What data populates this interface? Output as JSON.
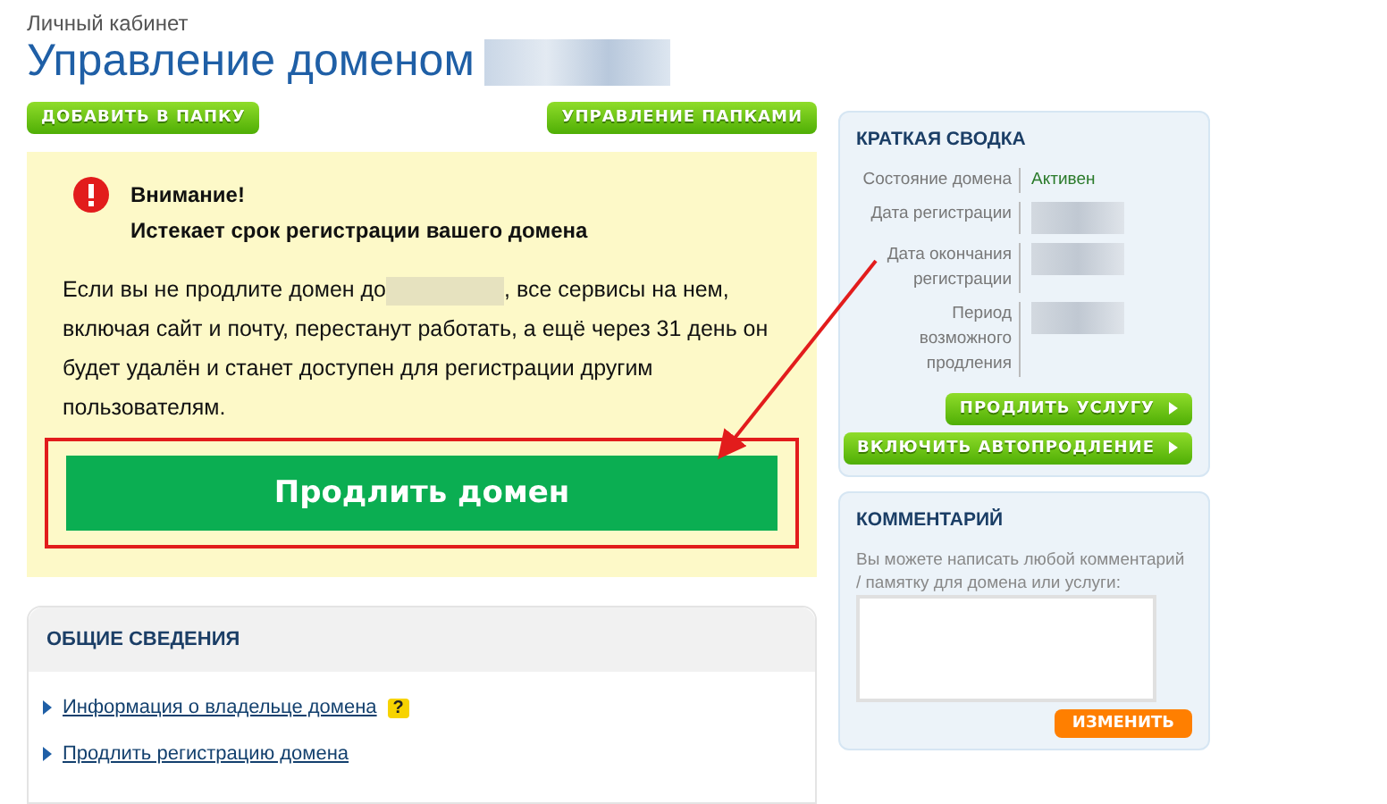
{
  "breadcrumb": "Личный кабинет",
  "title": "Управление доменом",
  "folder_buttons": [
    {
      "label": "ДОБАВИТЬ В ПАПКУ"
    },
    {
      "label": "УПРАВЛЕНИЕ ПАПКАМИ"
    }
  ],
  "warning": {
    "heading": "Внимание!",
    "subheading": "Истекает срок регистрации вашего домена",
    "text_before": "Если вы не продлите домен до",
    "text_after": ", все сервисы на нем, включая сайт и почту, перестанут работать, а ещё через 31 день он будет удалён и станет доступен для регистрации другим пользователям.",
    "button": "Продлить домен",
    "highlighted": true
  },
  "general": {
    "title": "ОБЩИЕ СВЕДЕНИЯ",
    "links": [
      {
        "label": "Информация о владельце домена",
        "help": "?"
      },
      {
        "label": "Продлить регистрацию домена"
      }
    ]
  },
  "summary": {
    "title": "КРАТКАЯ СВОДКА",
    "rows": [
      {
        "label": "Состояние домена",
        "value": "Активен",
        "kind": "text"
      },
      {
        "label": "Дата регистрации",
        "kind": "hidden"
      },
      {
        "label": "Дата окончания регистрации",
        "kind": "hidden"
      },
      {
        "label": "Период возможного продления",
        "kind": "hidden"
      }
    ],
    "buttons": [
      {
        "label": "ПРОДЛИТЬ УСЛУГУ"
      },
      {
        "label": "ВКЛЮЧИТЬ АВТОПРОДЛЕНИЕ"
      }
    ]
  },
  "comment": {
    "title": "КОММЕНТАРИЙ",
    "hint": "Вы можете написать любой комментарий / памятку для домена или услуги:",
    "button": "ИЗМЕНИТЬ"
  }
}
